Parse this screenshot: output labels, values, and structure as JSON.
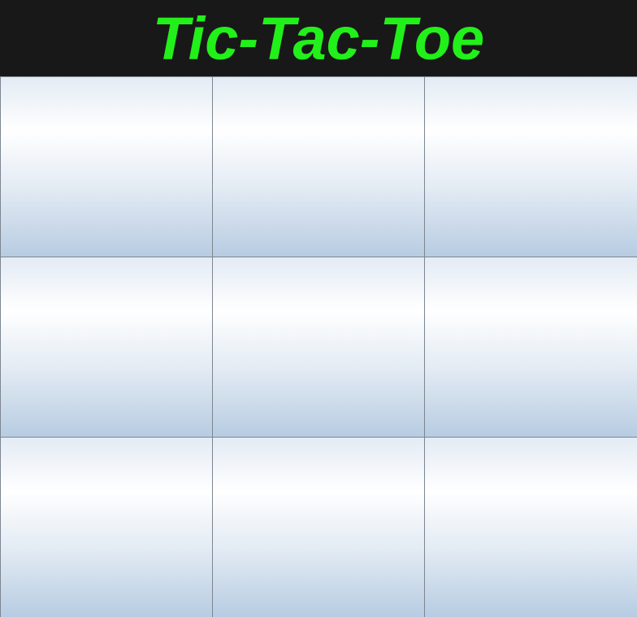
{
  "header": {
    "title": "Tic-Tac-Toe",
    "title_color": "#22f01a",
    "background_color": "#181818"
  },
  "board": {
    "rows": 3,
    "cols": 3,
    "cells": [
      "",
      "",
      "",
      "",
      "",
      "",
      "",
      "",
      ""
    ]
  }
}
